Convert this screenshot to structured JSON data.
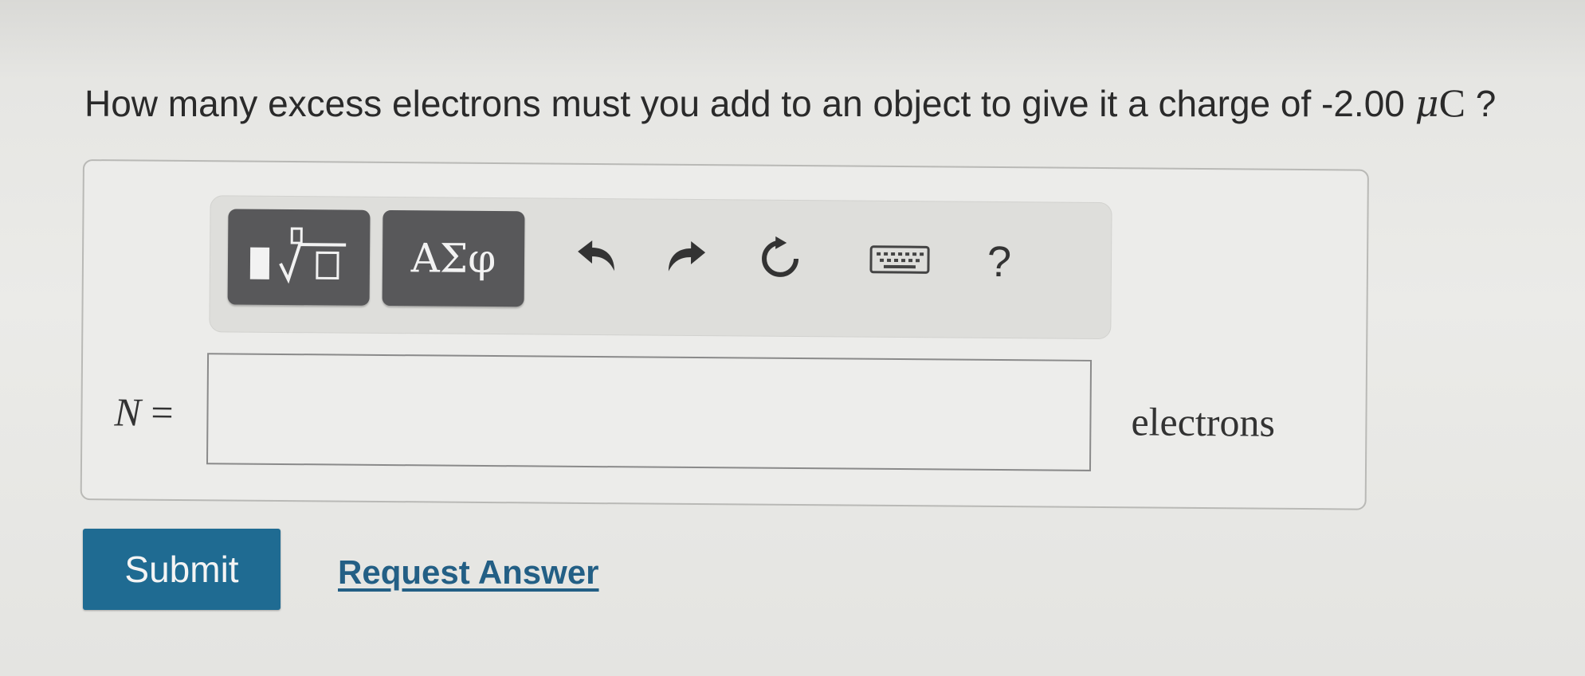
{
  "question": {
    "text_prefix": "How many excess electrons must you add to an object to give it a charge of -2.00 ",
    "unit_mu": "μ",
    "unit_c": "C",
    "text_suffix": " ?"
  },
  "toolbar": {
    "templates_icon": "fraction-root-template-icon",
    "greek_label": "ΑΣφ",
    "undo_icon": "undo-icon",
    "redo_icon": "redo-icon",
    "reset_icon": "reset-icon",
    "keyboard_icon": "keyboard-icon",
    "help_label": "?"
  },
  "answer": {
    "variable": "N",
    "equals": " =",
    "value": "",
    "unit": "electrons"
  },
  "actions": {
    "submit_label": "Submit",
    "request_answer_label": "Request Answer"
  },
  "colors": {
    "submit_bg": "#1f6b92",
    "link": "#235f85",
    "toolbar_button": "#58585a"
  }
}
